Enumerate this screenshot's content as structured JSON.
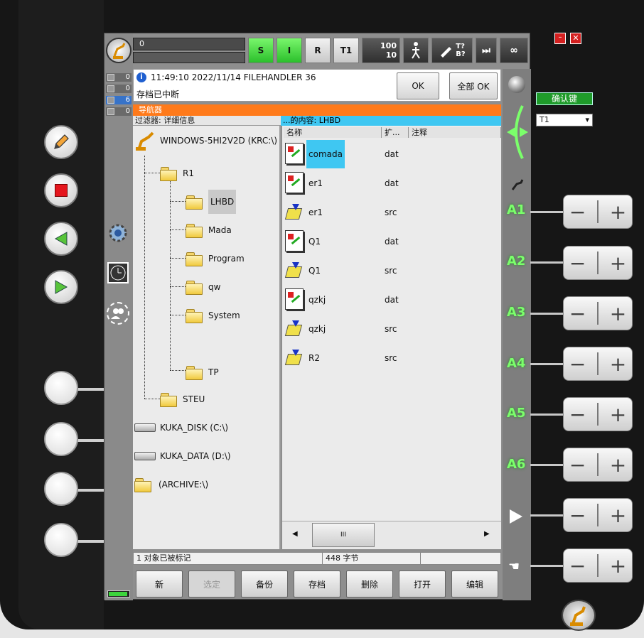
{
  "topbar": {
    "program_field": "0",
    "btn_s": "S",
    "btn_i": "I",
    "btn_r": "R",
    "btn_t1": "T1",
    "override_run": "100",
    "override_jog": "10",
    "tq": "T?",
    "bq": "B?",
    "infinity": "∞"
  },
  "counters": [
    "0",
    "0",
    "6",
    "0"
  ],
  "message": {
    "header": "11:49:10 2022/11/14 FILEHANDLER 36",
    "text": "存档已中断",
    "ok": "OK",
    "all_ok": "全部 OK"
  },
  "navigator": {
    "title": "导航器",
    "filter": "过滤器: 详细信息",
    "content_of": "...的内容: LHBD",
    "columns": [
      "名称",
      "扩...",
      "注释"
    ],
    "tree": {
      "root": "WINDOWS-5HI2V2D (KRC:\\)",
      "r1": "R1",
      "r1_children": [
        "LHBD",
        "Mada",
        "Program",
        "qw",
        "System",
        "TP"
      ],
      "steu": "STEU",
      "drive_c": "KUKA_DISK (C:\\)",
      "drive_d": "KUKA_DATA (D:\\)",
      "archive": "(ARCHIVE:\\)"
    },
    "files": [
      {
        "name": "comada",
        "ext": "dat",
        "type": "dat",
        "selected": true
      },
      {
        "name": "er1",
        "ext": "dat",
        "type": "dat",
        "selected": false
      },
      {
        "name": "er1",
        "ext": "src",
        "type": "src",
        "selected": false
      },
      {
        "name": "Q1",
        "ext": "dat",
        "type": "dat",
        "selected": false
      },
      {
        "name": "Q1",
        "ext": "src",
        "type": "src",
        "selected": false
      },
      {
        "name": "qzkj",
        "ext": "dat",
        "type": "dat",
        "selected": false
      },
      {
        "name": "qzkj",
        "ext": "src",
        "type": "src",
        "selected": false
      },
      {
        "name": "R2",
        "ext": "src",
        "type": "src",
        "selected": false
      }
    ],
    "scroll_thumb": "III",
    "status_marked": "1 对象已被标记",
    "status_bytes": "448 字节"
  },
  "buttons": {
    "new": "新",
    "select": "选定",
    "backup": "备份",
    "archive": "存档",
    "delete": "删除",
    "open": "打开",
    "edit": "编辑"
  },
  "right": {
    "confirm": "确认键",
    "mode_select": "T1",
    "axes": [
      "A1",
      "A2",
      "A3",
      "A4",
      "A5",
      "A6"
    ]
  },
  "colors": {
    "navigator_title": "#ff7a1a",
    "content_bar": "#3fc7f2",
    "selection": "#3fc7f2",
    "status_green": "#47d647",
    "axis_label": "#7bff6b"
  }
}
